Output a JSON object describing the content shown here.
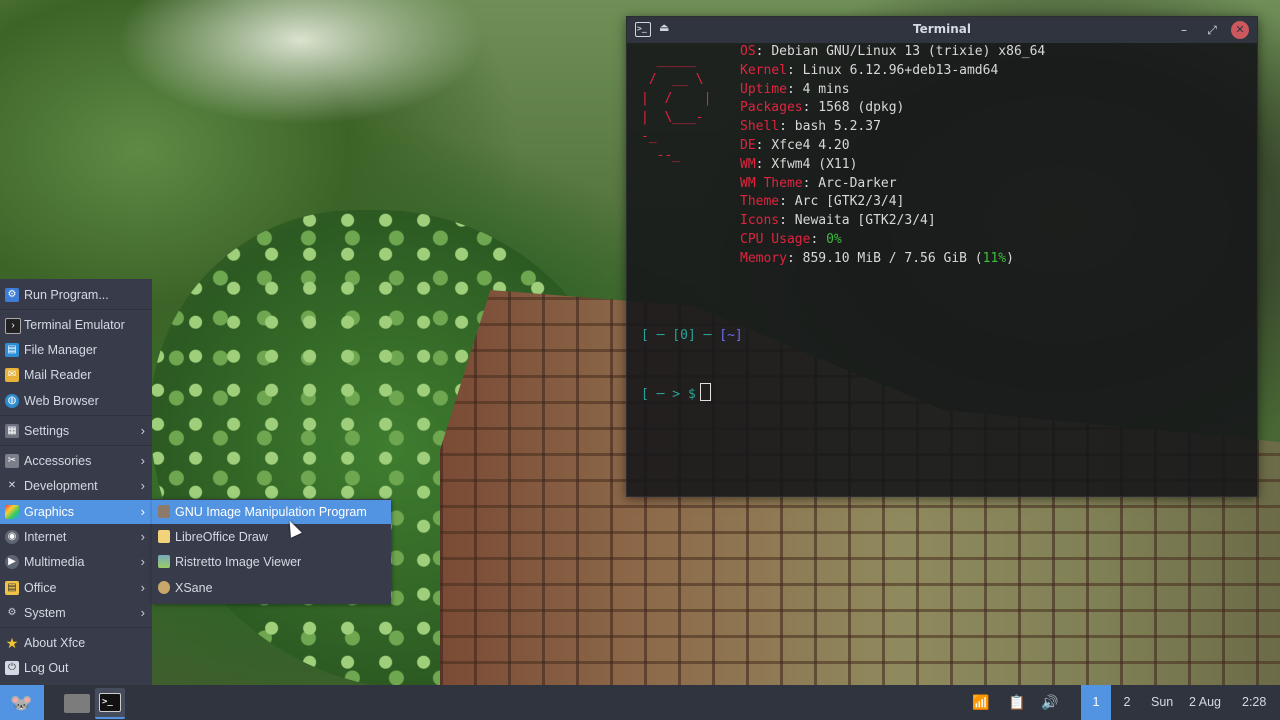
{
  "terminal": {
    "title": "Terminal",
    "logo": "  _____\n /  __ \\\n|  /    |\n|  \\___-\n-_\n  --_",
    "info": [
      {
        "key": "OS",
        "value": "Debian GNU/Linux 13 (trixie) x86_64"
      },
      {
        "key": "Kernel",
        "value": "Linux 6.12.96+deb13-amd64"
      },
      {
        "key": "Uptime",
        "value": "4 mins"
      },
      {
        "key": "Packages",
        "value": "1568 (dpkg)"
      },
      {
        "key": "Shell",
        "value": "bash 5.2.37"
      },
      {
        "key": "DE",
        "value": "Xfce4 4.20"
      },
      {
        "key": "WM",
        "value": "Xfwm4 (X11)"
      },
      {
        "key": "WM Theme",
        "value": "Arc-Darker"
      },
      {
        "key": "Theme",
        "value": "Arc [GTK2/3/4]"
      },
      {
        "key": "Icons",
        "value": "Newaita [GTK2/3/4]"
      }
    ],
    "cpu": {
      "key": "CPU Usage",
      "value": "0%"
    },
    "memory": {
      "key": "Memory",
      "value_a": "859.10 MiB / 7.56 GiB (",
      "percent": "11%",
      "value_b": ")"
    },
    "prompt": {
      "line1_open": "[ ─ [0] ─ ",
      "line1_dir": "[~]",
      "line2": "[ ─ > $"
    }
  },
  "menu": {
    "items": [
      {
        "label": "Run Program...",
        "icon": "run-program-icon"
      },
      {
        "label": "Terminal Emulator",
        "icon": "terminal-icon"
      },
      {
        "label": "File Manager",
        "icon": "file-manager-icon"
      },
      {
        "label": "Mail Reader",
        "icon": "mail-icon"
      },
      {
        "label": "Web Browser",
        "icon": "web-browser-icon"
      },
      {
        "label": "Settings",
        "icon": "settings-icon"
      },
      {
        "label": "Accessories",
        "icon": "accessories-icon"
      },
      {
        "label": "Development",
        "icon": "development-icon"
      },
      {
        "label": "Graphics",
        "icon": "graphics-icon"
      },
      {
        "label": "Internet",
        "icon": "internet-icon"
      },
      {
        "label": "Multimedia",
        "icon": "multimedia-icon"
      },
      {
        "label": "Office",
        "icon": "office-icon"
      },
      {
        "label": "System",
        "icon": "system-icon"
      },
      {
        "label": "About Xfce",
        "icon": "about-xfce-icon"
      },
      {
        "label": "Log Out",
        "icon": "log-out-icon"
      }
    ],
    "graphics_submenu": [
      {
        "label": "GNU Image Manipulation Program",
        "icon": "gimp-icon"
      },
      {
        "label": "LibreOffice Draw",
        "icon": "libreoffice-draw-icon"
      },
      {
        "label": "Ristretto Image Viewer",
        "icon": "ristretto-icon"
      },
      {
        "label": "XSane",
        "icon": "xsane-icon"
      }
    ]
  },
  "panel": {
    "workspaces": [
      "1",
      "2"
    ],
    "day": "Sun",
    "date": "2 Aug",
    "time": "2:28"
  },
  "colors": {
    "accent": "#5294e2",
    "menu_bg": "#383c4a",
    "panel_bg": "#2f343f",
    "terminal_key": "#e0243f",
    "terminal_green": "#3cbf3c"
  }
}
